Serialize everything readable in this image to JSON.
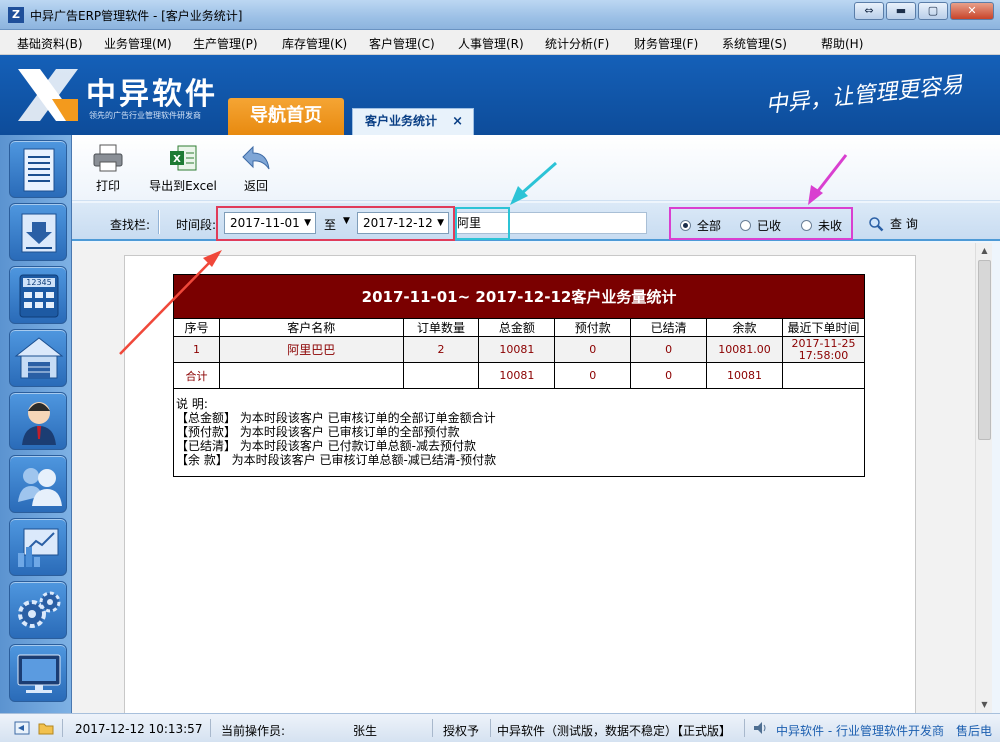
{
  "window": {
    "title": "中异广告ERP管理软件 - [客户业务统计]",
    "app_icon": "Z",
    "buttons": {
      "restore": "⇔",
      "minimize": "▬",
      "maximize": "▢",
      "close": "✕"
    }
  },
  "menu": [
    "基础资料(B)",
    "业务管理(M)",
    "生产管理(P)",
    "库存管理(K)",
    "客户管理(C)",
    "人事管理(R)",
    "统计分析(F)",
    "财务管理(F)",
    "系统管理(S)",
    "帮助(H)"
  ],
  "banner": {
    "brand": "中异软件",
    "tagline": "领先的广告行业管理软件研发商",
    "slogan": "中异，让管理更容易",
    "nav_home": "导航首页",
    "active_tab": "客户业务统计",
    "tab_close": "×"
  },
  "toolbar": {
    "print": "打印",
    "export": "导出到Excel",
    "back": "返回"
  },
  "search": {
    "label": "查找栏:",
    "period_label": "时间段:",
    "date_from": "2017-11-01",
    "to_label": "至",
    "date_to": "2017-12-12",
    "customer_value": "阿里",
    "radio_all": "全部",
    "radio_received": "已收",
    "radio_unreceived": "未收",
    "query": "查 询"
  },
  "report": {
    "title": "2017-11-01~ 2017-12-12客户业务量统计",
    "columns": [
      "序号",
      "客户名称",
      "订单数量",
      "总金额",
      "预付款",
      "已结清",
      "余款",
      "最近下单时间"
    ],
    "rows": [
      {
        "no": "1",
        "name": "阿里巴巴",
        "orders": "2",
        "total": "10081",
        "prepaid": "0",
        "settled": "0",
        "balance": "10081.00",
        "last_date": "2017-11-25",
        "last_time": "17:58:00"
      }
    ],
    "summary": {
      "label": "合计",
      "total": "10081",
      "prepaid": "0",
      "settled": "0",
      "balance": "10081"
    },
    "notes": [
      "说  明:",
      "【总金额】 为本时段该客户 已审核订单的全部订单金额合计",
      "【预付款】 为本时段该客户 已审核订单的全部预付款",
      "【已结清】 为本时段该客户 已付款订单总额-减去预付款",
      "【余  款】 为本时段该客户 已审核订单总额-减已结清-预付款"
    ]
  },
  "status": {
    "datetime": "2017-12-12 10:13:57",
    "operator_label": "当前操作员:",
    "operator": "张生",
    "license_label": "授权予",
    "license": "中异软件（测试版，数据不稳定）【正式版】",
    "company": "中异软件 - 行业管理软件开发商",
    "after_sales": "售后电"
  },
  "colors": {
    "report_title_bg": "#7a0000",
    "banner": "#1560b8",
    "nav_home": "#f5a534",
    "highlight_red": "#e03c5a",
    "highlight_cyan": "#2cc3d6",
    "highlight_magenta": "#d93fd0"
  }
}
